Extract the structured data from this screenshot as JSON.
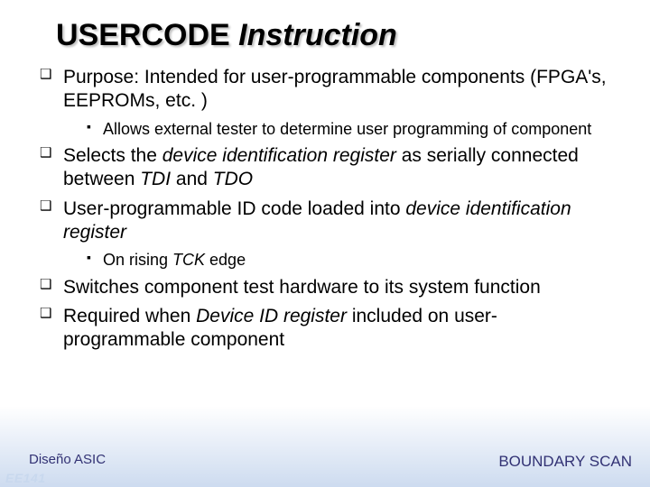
{
  "title": {
    "word1": "USERCODE",
    "word2": "Instruction"
  },
  "bullets": {
    "b1a": "Purpose: Intended for user-programmable  components (FPGA's, EEPROMs, etc. )",
    "b1sub": "Allows external tester to determine user  programming of component",
    "b2_pre": "Selects the ",
    "b2_i1": "device identification register",
    "b2_mid": " as  serially connected between ",
    "b2_i2": "TDI",
    "b2_and": " and ",
    "b2_i3": "TDO",
    "b3_pre": "User-programmable ID code loaded into ",
    "b3_i1": "device identification register",
    "b3sub_pre": "On rising ",
    "b3sub_i": "TCK",
    "b3sub_post": " edge",
    "b4": "Switches component test hardware to its  system function",
    "b5_pre": "Required when ",
    "b5_i": "Device ID register",
    "b5_post": " included on  user-programmable component"
  },
  "footer": {
    "left": "Diseño ASIC",
    "right": "BOUNDARY SCAN",
    "watermark": "EE141"
  }
}
